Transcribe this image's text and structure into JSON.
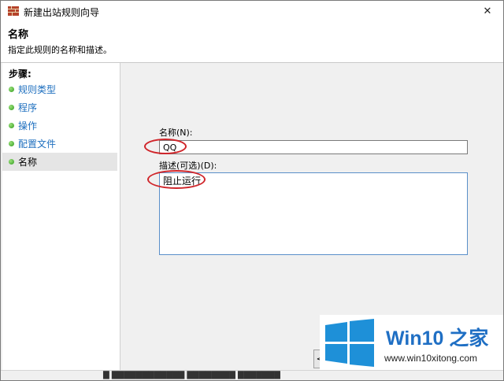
{
  "window": {
    "title": "新建出站规则向导",
    "close_label": "✕"
  },
  "header": {
    "title": "名称",
    "subtitle": "指定此规则的名称和描述。"
  },
  "steps": {
    "heading": "步骤:",
    "items": [
      {
        "label": "规则类型",
        "active": false
      },
      {
        "label": "程序",
        "active": false
      },
      {
        "label": "操作",
        "active": false
      },
      {
        "label": "配置文件",
        "active": false
      },
      {
        "label": "名称",
        "active": true
      }
    ]
  },
  "form": {
    "name_label": "名称(N):",
    "name_value": "QQ",
    "description_label": "描述(可选)(D):",
    "description_value": "阻止运行"
  },
  "buttons": {
    "back_label": "<"
  },
  "colors": {
    "annotation_circle": "#d0262b",
    "step_link": "#1e6fbf",
    "watermark_blue": "#1f6fc4"
  },
  "watermark": {
    "title": "Win10 之家",
    "url": "www.win10xitong.com"
  }
}
